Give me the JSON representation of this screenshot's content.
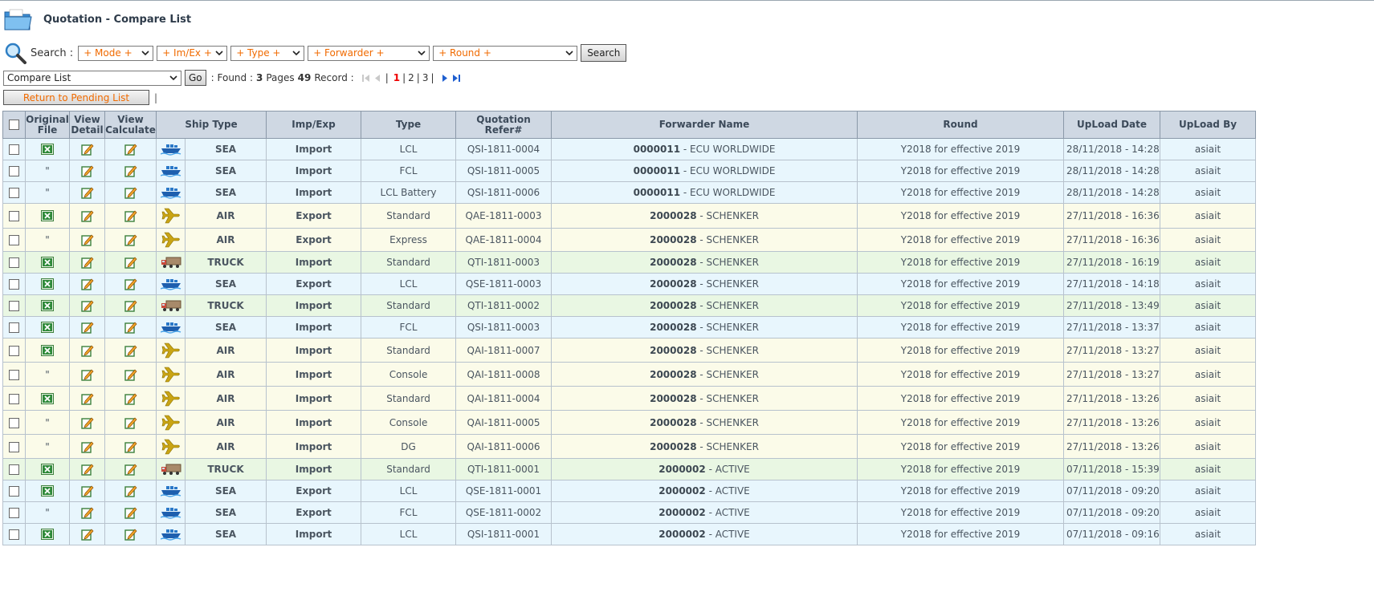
{
  "header": {
    "title": "Quotation - Compare List"
  },
  "search": {
    "label": "Search :",
    "mode": "+ Mode +",
    "imex": "+ Im/Ex +",
    "type": "+ Type +",
    "forwarder": "+ Forwarder +",
    "round": "+ Round +",
    "button": "Search"
  },
  "nav": {
    "list_select": "Compare List",
    "go": "Go",
    "found_label": ": Found :",
    "pages": "3",
    "pages_label": "Pages",
    "records": "49",
    "record_label": "Record :",
    "page_links": [
      "1",
      "2",
      "3"
    ],
    "current_page": "1"
  },
  "actions": {
    "return_label": "Return to Pending List",
    "sep": "|"
  },
  "table": {
    "headers": {
      "original_file": "Original File",
      "view_detail": "View Detail",
      "view_calculate": "View Calculate",
      "ship_type": "Ship Type",
      "imp_exp": "Imp/Exp",
      "type": "Type",
      "quotation_refer": "Quotation Refer#",
      "forwarder_name": "Forwarder Name",
      "round": "Round",
      "upload_date": "UpLoad Date",
      "upload_by": "UpLoad By"
    },
    "rows": [
      {
        "file": "excel",
        "ship": "SEA",
        "impexp": "Import",
        "type": "LCL",
        "ref": "QSI-1811-0004",
        "fwd_code": "0000011",
        "fwd_name": "- ECU WORLDWIDE",
        "round": "Y2018 for effective 2019",
        "date": "28/11/2018 - 14:28",
        "by": "asiait"
      },
      {
        "file": "\"",
        "ship": "SEA",
        "impexp": "Import",
        "type": "FCL",
        "ref": "QSI-1811-0005",
        "fwd_code": "0000011",
        "fwd_name": "- ECU WORLDWIDE",
        "round": "Y2018 for effective 2019",
        "date": "28/11/2018 - 14:28",
        "by": "asiait"
      },
      {
        "file": "\"",
        "ship": "SEA",
        "impexp": "Import",
        "type": "LCL Battery",
        "ref": "QSI-1811-0006",
        "fwd_code": "0000011",
        "fwd_name": "- ECU WORLDWIDE",
        "round": "Y2018 for effective 2019",
        "date": "28/11/2018 - 14:28",
        "by": "asiait"
      },
      {
        "file": "excel",
        "ship": "AIR",
        "impexp": "Export",
        "type": "Standard",
        "ref": "QAE-1811-0003",
        "fwd_code": "2000028",
        "fwd_name": "- SCHENKER",
        "round": "Y2018 for effective 2019",
        "date": "27/11/2018 - 16:36",
        "by": "asiait"
      },
      {
        "file": "\"",
        "ship": "AIR",
        "impexp": "Export",
        "type": "Express",
        "ref": "QAE-1811-0004",
        "fwd_code": "2000028",
        "fwd_name": "- SCHENKER",
        "round": "Y2018 for effective 2019",
        "date": "27/11/2018 - 16:36",
        "by": "asiait"
      },
      {
        "file": "excel",
        "ship": "TRUCK",
        "impexp": "Import",
        "type": "Standard",
        "ref": "QTI-1811-0003",
        "fwd_code": "2000028",
        "fwd_name": "- SCHENKER",
        "round": "Y2018 for effective 2019",
        "date": "27/11/2018 - 16:19",
        "by": "asiait"
      },
      {
        "file": "excel",
        "ship": "SEA",
        "impexp": "Export",
        "type": "LCL",
        "ref": "QSE-1811-0003",
        "fwd_code": "2000028",
        "fwd_name": "- SCHENKER",
        "round": "Y2018 for effective 2019",
        "date": "27/11/2018 - 14:18",
        "by": "asiait"
      },
      {
        "file": "excel",
        "ship": "TRUCK",
        "impexp": "Import",
        "type": "Standard",
        "ref": "QTI-1811-0002",
        "fwd_code": "2000028",
        "fwd_name": "- SCHENKER",
        "round": "Y2018 for effective 2019",
        "date": "27/11/2018 - 13:49",
        "by": "asiait"
      },
      {
        "file": "excel",
        "ship": "SEA",
        "impexp": "Import",
        "type": "FCL",
        "ref": "QSI-1811-0003",
        "fwd_code": "2000028",
        "fwd_name": "- SCHENKER",
        "round": "Y2018 for effective 2019",
        "date": "27/11/2018 - 13:37",
        "by": "asiait"
      },
      {
        "file": "excel",
        "ship": "AIR",
        "impexp": "Import",
        "type": "Standard",
        "ref": "QAI-1811-0007",
        "fwd_code": "2000028",
        "fwd_name": "- SCHENKER",
        "round": "Y2018 for effective 2019",
        "date": "27/11/2018 - 13:27",
        "by": "asiait"
      },
      {
        "file": "\"",
        "ship": "AIR",
        "impexp": "Import",
        "type": "Console",
        "ref": "QAI-1811-0008",
        "fwd_code": "2000028",
        "fwd_name": "- SCHENKER",
        "round": "Y2018 for effective 2019",
        "date": "27/11/2018 - 13:27",
        "by": "asiait"
      },
      {
        "file": "excel",
        "ship": "AIR",
        "impexp": "Import",
        "type": "Standard",
        "ref": "QAI-1811-0004",
        "fwd_code": "2000028",
        "fwd_name": "- SCHENKER",
        "round": "Y2018 for effective 2019",
        "date": "27/11/2018 - 13:26",
        "by": "asiait"
      },
      {
        "file": "\"",
        "ship": "AIR",
        "impexp": "Import",
        "type": "Console",
        "ref": "QAI-1811-0005",
        "fwd_code": "2000028",
        "fwd_name": "- SCHENKER",
        "round": "Y2018 for effective 2019",
        "date": "27/11/2018 - 13:26",
        "by": "asiait"
      },
      {
        "file": "\"",
        "ship": "AIR",
        "impexp": "Import",
        "type": "DG",
        "ref": "QAI-1811-0006",
        "fwd_code": "2000028",
        "fwd_name": "- SCHENKER",
        "round": "Y2018 for effective 2019",
        "date": "27/11/2018 - 13:26",
        "by": "asiait"
      },
      {
        "file": "excel",
        "ship": "TRUCK",
        "impexp": "Import",
        "type": "Standard",
        "ref": "QTI-1811-0001",
        "fwd_code": "2000002",
        "fwd_name": "- ACTIVE",
        "round": "Y2018 for effective 2019",
        "date": "07/11/2018 - 15:39",
        "by": "asiait"
      },
      {
        "file": "excel",
        "ship": "SEA",
        "impexp": "Export",
        "type": "LCL",
        "ref": "QSE-1811-0001",
        "fwd_code": "2000002",
        "fwd_name": "- ACTIVE",
        "round": "Y2018 for effective 2019",
        "date": "07/11/2018 - 09:20",
        "by": "asiait"
      },
      {
        "file": "\"",
        "ship": "SEA",
        "impexp": "Export",
        "type": "FCL",
        "ref": "QSE-1811-0002",
        "fwd_code": "2000002",
        "fwd_name": "- ACTIVE",
        "round": "Y2018 for effective 2019",
        "date": "07/11/2018 - 09:20",
        "by": "asiait"
      },
      {
        "file": "excel",
        "ship": "SEA",
        "impexp": "Import",
        "type": "LCL",
        "ref": "QSI-1811-0001",
        "fwd_code": "2000002",
        "fwd_name": "- ACTIVE",
        "round": "Y2018 for effective 2019",
        "date": "07/11/2018 - 09:16",
        "by": "asiait"
      }
    ]
  }
}
